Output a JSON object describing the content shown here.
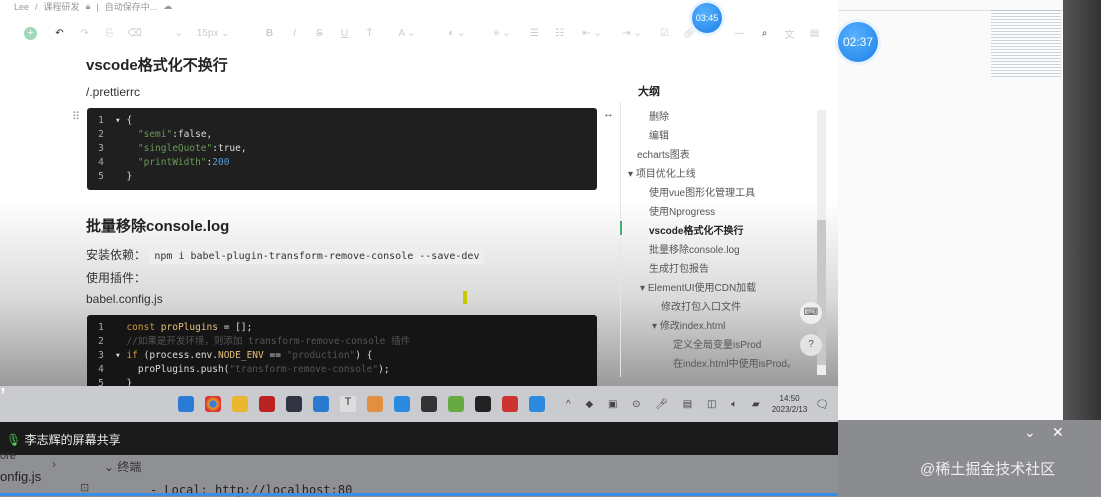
{
  "breadcrumb": {
    "user": "Lee",
    "folder": "课程研发",
    "status": "自动保存中..."
  },
  "toolbar": {
    "font_size": "15px"
  },
  "timers": {
    "small": "03:45",
    "large": "02:37"
  },
  "doc": {
    "h1": "vscode格式化不换行",
    "file1": "/.prettierrc",
    "code1": [
      {
        "n": "1",
        "t": "{"
      },
      {
        "n": "2",
        "k": "\"semi\"",
        "v": ":false,"
      },
      {
        "n": "3",
        "k": "\"singleQuote\"",
        "v": ":true,"
      },
      {
        "n": "4",
        "k": "\"printWidth\"",
        "v": ":",
        "num": "200"
      },
      {
        "n": "5",
        "t": "}"
      }
    ],
    "h2": "批量移除console.log",
    "install_label": "安装依赖：",
    "install_cmd": "npm i babel-plugin-transform-remove-console --save-dev",
    "use_plugin": "使用插件：",
    "file2": "babel.config.js",
    "code2": [
      {
        "n": "1",
        "a": "const ",
        "b": "proPlugins",
        "c": " = [];"
      },
      {
        "n": "2",
        "cm": "//如果是开发环境，则添加 transform-remove-console 插件"
      },
      {
        "n": "3",
        "a": "if ",
        "c": "(process.env.",
        "b": "NODE_ENV",
        "d": " == ",
        "s": "\"production\"",
        "e": ") {"
      },
      {
        "n": "4",
        "c": "  proPlugins.push(",
        "s": "\"transform-remove-console\"",
        "e": ");"
      },
      {
        "n": "5",
        "c": "}"
      }
    ]
  },
  "outline": {
    "title": "大纲",
    "items": [
      "删除",
      "编辑",
      "echarts图表",
      "项目优化上线",
      "使用vue图形化管理工具",
      "使用Nprogress",
      "vscode格式化不换行",
      "批量移除console.log",
      "生成打包报告",
      "ElementUI使用CDN加载",
      "修改打包入口文件",
      "修改index.html",
      "定义全局变量isProd",
      "在index.html中使用isProd。"
    ]
  },
  "taskbar": {
    "time": "14:50",
    "date": "2023/2/13"
  },
  "share_label": "李志辉的屏幕共享",
  "bottom": {
    "left1": "ore",
    "left2": "onfig.js",
    "terminal_tab": "终端",
    "terminal_line": "- Local:   http://localhost:80"
  },
  "watermark": "@稀土掘金技术社区"
}
